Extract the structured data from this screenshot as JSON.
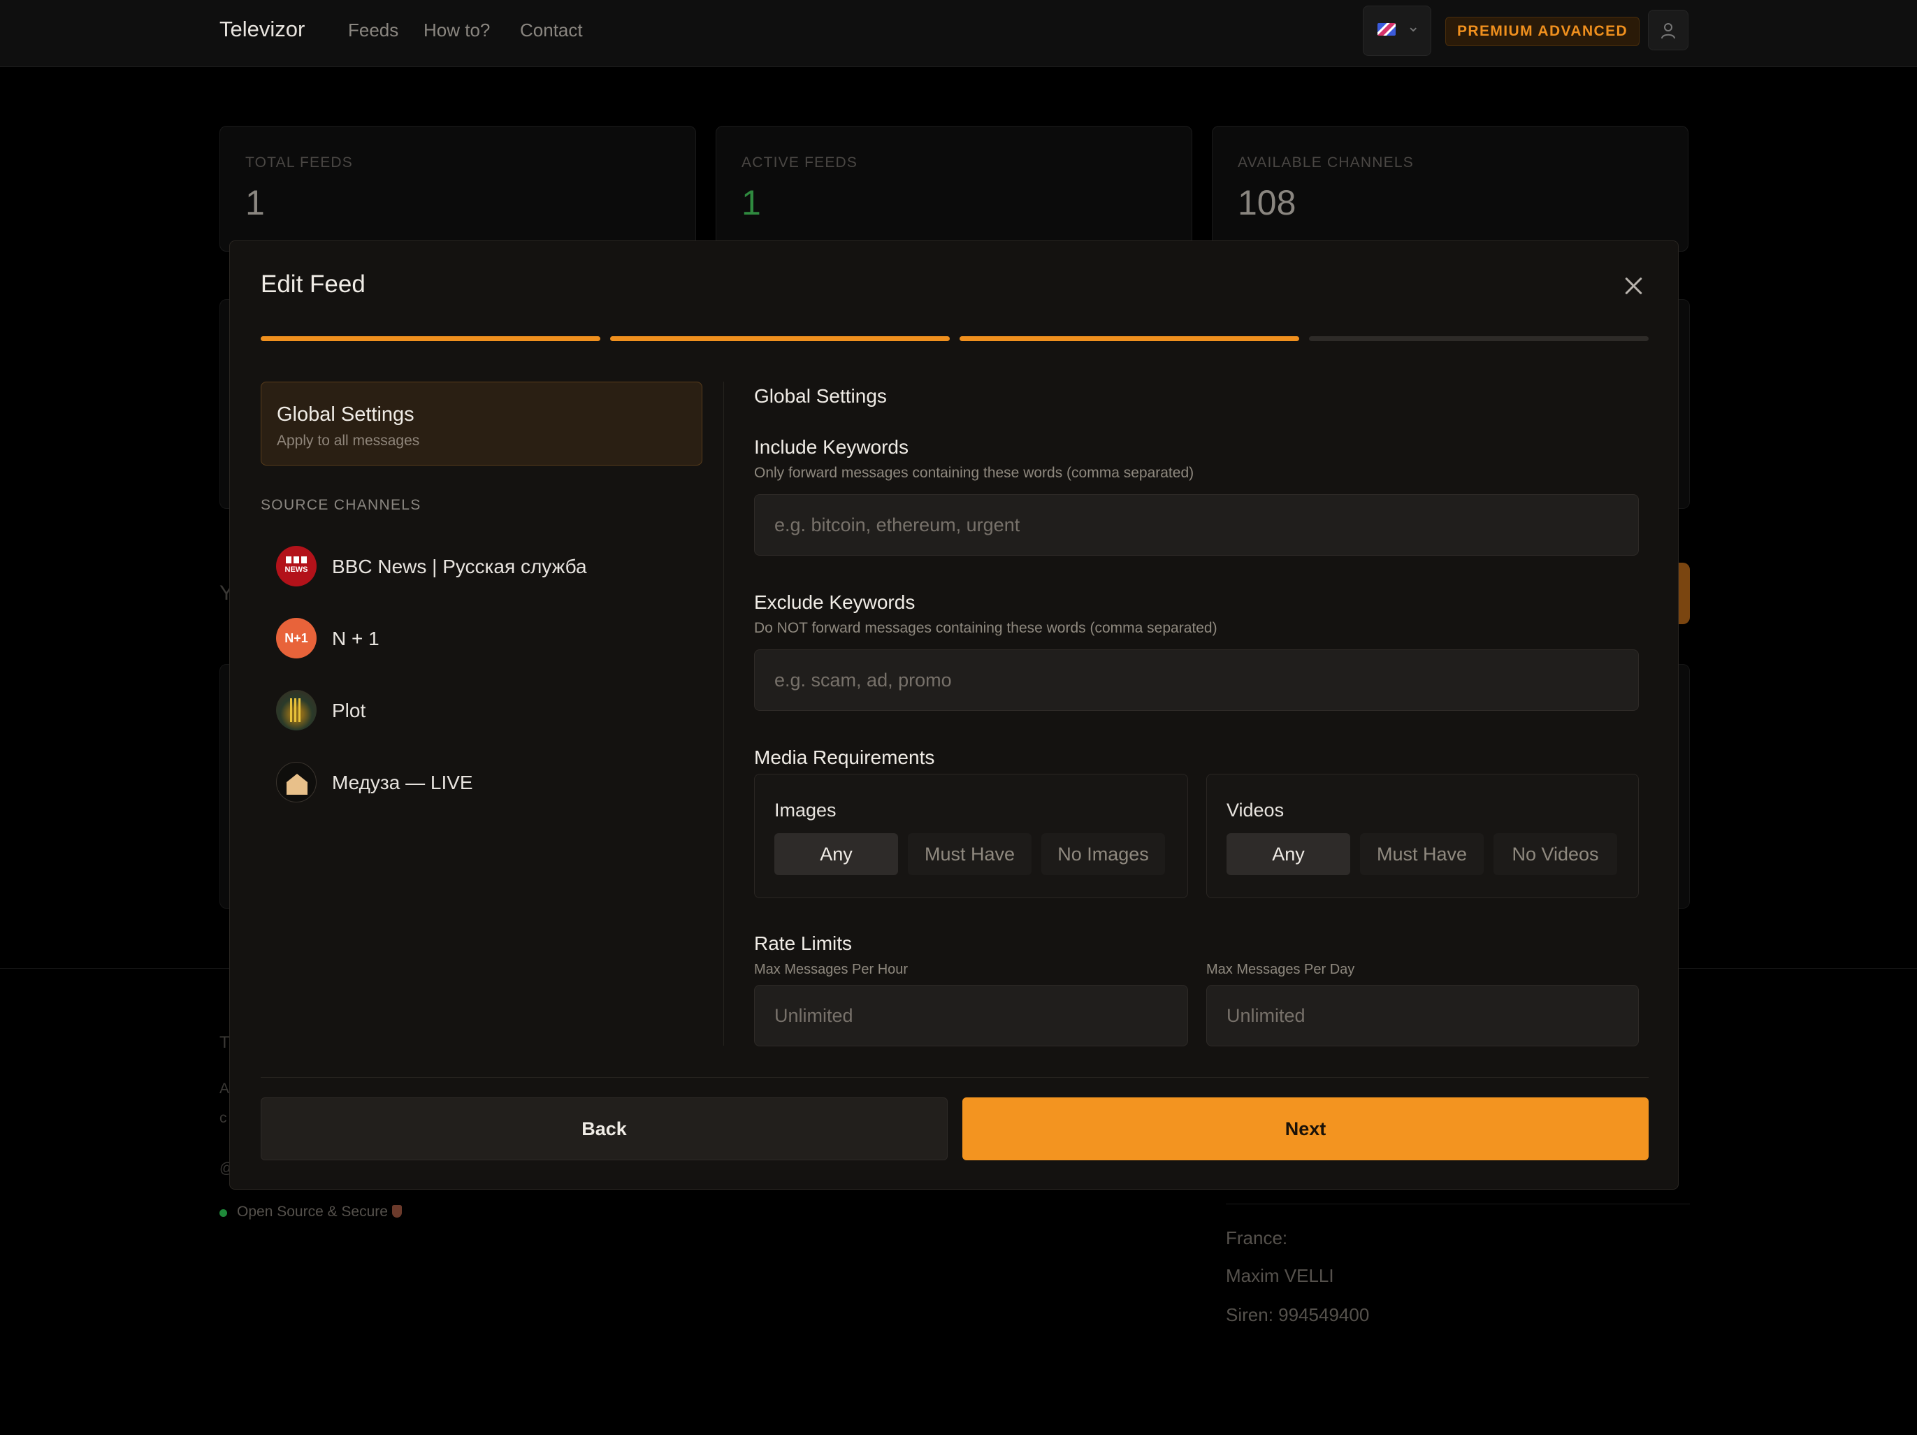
{
  "header": {
    "brand": "Televizor",
    "nav": [
      "Feeds",
      "How to?",
      "Contact"
    ],
    "premium_badge": "PREMIUM ADVANCED"
  },
  "stats": [
    {
      "label": "TOTAL FEEDS",
      "value": "1"
    },
    {
      "label": "ACTIVE FEEDS",
      "value": "1"
    },
    {
      "label": "AVAILABLE CHANNELS",
      "value": "108"
    }
  ],
  "footer": {
    "open_source": "Open Source & Secure",
    "country": "France:",
    "owner": "Maxim VELLI",
    "siren": "Siren: 994549400"
  },
  "modal": {
    "title": "Edit Feed",
    "steps_total": 4,
    "steps_completed": 3,
    "global_settings": {
      "title": "Global Settings",
      "subtitle": "Apply to all messages"
    },
    "source_channels_label": "SOURCE CHANNELS",
    "channels": [
      {
        "name": "BBC News | Русская служба"
      },
      {
        "name": "N + 1",
        "avatar_text": "N+1"
      },
      {
        "name": "Plot"
      },
      {
        "name": "Медуза — LIVE"
      }
    ],
    "section_title": "Global Settings",
    "include": {
      "title": "Include Keywords",
      "hint": "Only forward messages containing these words (comma separated)",
      "value": "",
      "placeholder": "e.g. bitcoin, ethereum, urgent"
    },
    "exclude": {
      "title": "Exclude Keywords",
      "hint": "Do NOT forward messages containing these words (comma separated)",
      "value": "",
      "placeholder": "e.g. scam, ad, promo"
    },
    "media": {
      "title": "Media Requirements",
      "images": {
        "title": "Images",
        "options": [
          "Any",
          "Must Have",
          "No Images"
        ],
        "selected": "Any"
      },
      "videos": {
        "title": "Videos",
        "options": [
          "Any",
          "Must Have",
          "No Videos"
        ],
        "selected": "Any"
      }
    },
    "rate_limits": {
      "title": "Rate Limits",
      "per_hour_label": "Max Messages Per Hour",
      "per_hour_placeholder": "Unlimited",
      "per_day_label": "Max Messages Per Day",
      "per_day_placeholder": "Unlimited"
    },
    "buttons": {
      "back": "Back",
      "next": "Next"
    }
  },
  "colors": {
    "accent": "#f39420",
    "modal_bg": "#141210",
    "page_bg": "#000000",
    "active_green": "#2f8a3f"
  },
  "icons": {
    "close": "close-icon",
    "user": "user-icon",
    "chevron": "chevron-down-icon",
    "flag": "uk-flag-icon"
  }
}
